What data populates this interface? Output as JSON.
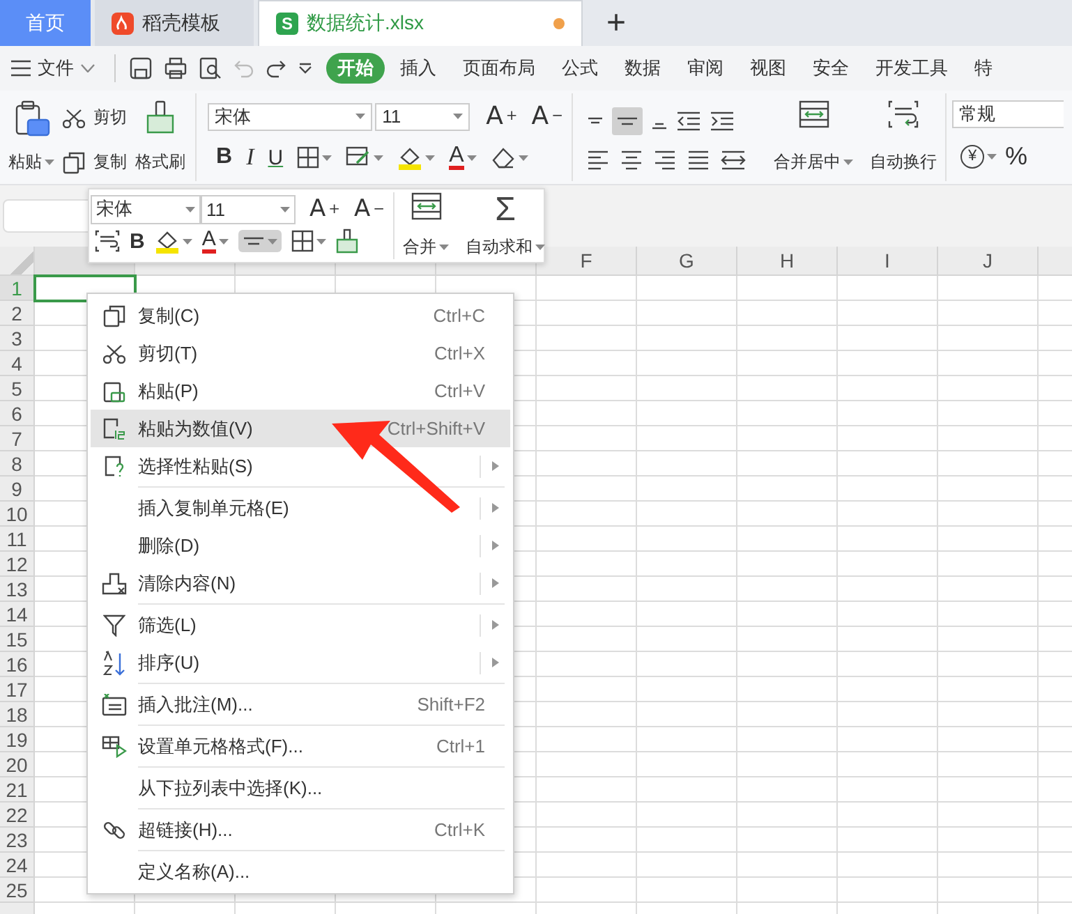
{
  "tabs": [
    {
      "label": "首页",
      "kind": "home",
      "selected": false
    },
    {
      "label": "稻壳模板",
      "kind": "docer",
      "selected": false
    },
    {
      "label": "数据统计.xlsx",
      "kind": "sheet",
      "badge": "S",
      "selected": true,
      "unsaved": true
    }
  ],
  "new_tab": "+",
  "menu": {
    "file": "文件",
    "tabs": [
      {
        "label": "开始",
        "selected": true
      },
      {
        "label": "插入",
        "selected": false
      },
      {
        "label": "页面布局",
        "selected": false
      },
      {
        "label": "公式",
        "selected": false
      },
      {
        "label": "数据",
        "selected": false
      },
      {
        "label": "审阅",
        "selected": false
      },
      {
        "label": "视图",
        "selected": false
      },
      {
        "label": "安全",
        "selected": false
      },
      {
        "label": "开发工具",
        "selected": false
      },
      {
        "label": "特",
        "selected": false
      }
    ]
  },
  "ribbon": {
    "paste": "粘贴",
    "cut": "剪切",
    "copy": "复制",
    "format_painter": "格式刷",
    "font": "宋体",
    "size": "11",
    "grow": "A$^{+}$",
    "shrink": "A$^{−}$",
    "bold": "B",
    "italic": "I",
    "underline": "U",
    "font_color": "A",
    "merge": "合并居中",
    "wrap": "自动换行",
    "number_format": "常规",
    "currency": "¥",
    "percent": "%"
  },
  "floating_toolbar": {
    "font": "宋体",
    "size": "11",
    "grow": "A$^{+}$",
    "shrink": "A$^{−}$",
    "bold": "B",
    "font_color": "A",
    "merge": "合并",
    "autosum_symbol": "Σ",
    "autosum": "自动求和"
  },
  "sheet": {
    "columns": [
      {
        "selected": true
      },
      {
        "selected": false
      },
      {
        "selected": false
      },
      {
        "selected": false
      },
      {
        "selected": false
      },
      {
        "label": "F",
        "selected": false
      },
      {
        "label": "G",
        "selected": false
      },
      {
        "label": "H",
        "selected": false
      },
      {
        "label": "I",
        "selected": false
      },
      {
        "label": "J",
        "selected": false
      }
    ],
    "rows": [
      {
        "label": "1",
        "selected": true
      },
      {
        "label": "2",
        "selected": false
      },
      {
        "label": "3",
        "selected": false
      },
      {
        "label": "4",
        "selected": false
      },
      {
        "label": "5",
        "selected": false
      },
      {
        "label": "6",
        "selected": false
      },
      {
        "label": "7",
        "selected": false
      },
      {
        "label": "8",
        "selected": false
      },
      {
        "label": "9",
        "selected": false
      },
      {
        "label": "10",
        "selected": false
      },
      {
        "label": "11",
        "selected": false
      },
      {
        "label": "12",
        "selected": false
      },
      {
        "label": "13",
        "selected": false
      },
      {
        "label": "14",
        "selected": false
      },
      {
        "label": "15",
        "selected": false
      },
      {
        "label": "16",
        "selected": false
      },
      {
        "label": "17",
        "selected": false
      },
      {
        "label": "18",
        "selected": false
      },
      {
        "label": "19",
        "selected": false
      },
      {
        "label": "20",
        "selected": false
      },
      {
        "label": "21",
        "selected": false
      },
      {
        "label": "22",
        "selected": false
      },
      {
        "label": "23",
        "selected": false
      },
      {
        "label": "24",
        "selected": false
      },
      {
        "label": "25",
        "selected": false
      }
    ]
  },
  "context_menu": [
    [
      {
        "label": "复制(C)",
        "shortcut": "Ctrl+C",
        "submenu": false,
        "selected": false
      },
      {
        "label": "剪切(T)",
        "shortcut": "Ctrl+X",
        "submenu": false,
        "selected": false
      },
      {
        "label": "粘贴(P)",
        "shortcut": "Ctrl+V",
        "submenu": false,
        "selected": false
      },
      {
        "label": "粘贴为数值(V)",
        "shortcut": "Ctrl+Shift+V",
        "submenu": false,
        "selected": true
      },
      {
        "label": "选择性粘贴(S)",
        "submenu": true,
        "selected": false
      }
    ],
    [
      {
        "label": "插入复制单元格(E)",
        "submenu": true,
        "selected": false
      },
      {
        "label": "删除(D)",
        "submenu": true,
        "selected": false
      },
      {
        "label": "清除内容(N)",
        "submenu": true,
        "selected": false
      }
    ],
    [
      {
        "label": "筛选(L)",
        "submenu": true,
        "selected": false
      },
      {
        "label": "排序(U)",
        "submenu": true,
        "selected": false
      }
    ],
    [
      {
        "label": "插入批注(M)...",
        "shortcut": "Shift+F2",
        "submenu": false,
        "selected": false
      }
    ],
    [
      {
        "label": "设置单元格格式(F)...",
        "shortcut": "Ctrl+1",
        "submenu": false,
        "selected": false
      }
    ],
    [
      {
        "label": "从下拉列表中选择(K)...",
        "submenu": false,
        "selected": false
      }
    ],
    [
      {
        "label": "超链接(H)...",
        "shortcut": "Ctrl+K",
        "submenu": false,
        "selected": false
      }
    ],
    [
      {
        "label": "定义名称(A)...",
        "submenu": false,
        "selected": false
      }
    ]
  ]
}
